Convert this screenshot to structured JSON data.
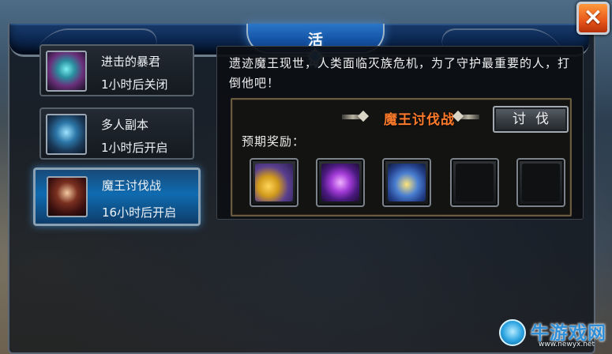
{
  "header": {
    "title": "活 动",
    "close_icon": "×"
  },
  "activities": [
    {
      "name": "进击的暴君",
      "status": "1小时后关闭",
      "icon": "tyrant-portrait-icon"
    },
    {
      "name": "多人副本",
      "status": "1小时后开启",
      "icon": "dungeon-portrait-icon"
    },
    {
      "name": "魔王讨伐战",
      "status": "16小时后开启",
      "icon": "demon-king-portrait-icon",
      "selected": true
    }
  ],
  "detail": {
    "description": "遗迹魔王现世，人类面临灭族危机，为了守护最重要的人，打倒他吧！",
    "event_title": "魔王讨伐战",
    "fight_button": "讨伐",
    "reward_label": "预期奖励：",
    "rewards": [
      {
        "icon": "gold-coins-icon"
      },
      {
        "icon": "purple-crystal-icon"
      },
      {
        "icon": "treasure-chest-icon"
      },
      {
        "icon": "empty-slot"
      },
      {
        "icon": "empty-slot"
      }
    ]
  },
  "watermark": {
    "name": "牛游戏网",
    "url": "www.newyx.net"
  },
  "colors": {
    "accent_orange": "#ff7a2a",
    "title_blue": "#1554a6",
    "selected_blue": "#0f6bb0"
  }
}
